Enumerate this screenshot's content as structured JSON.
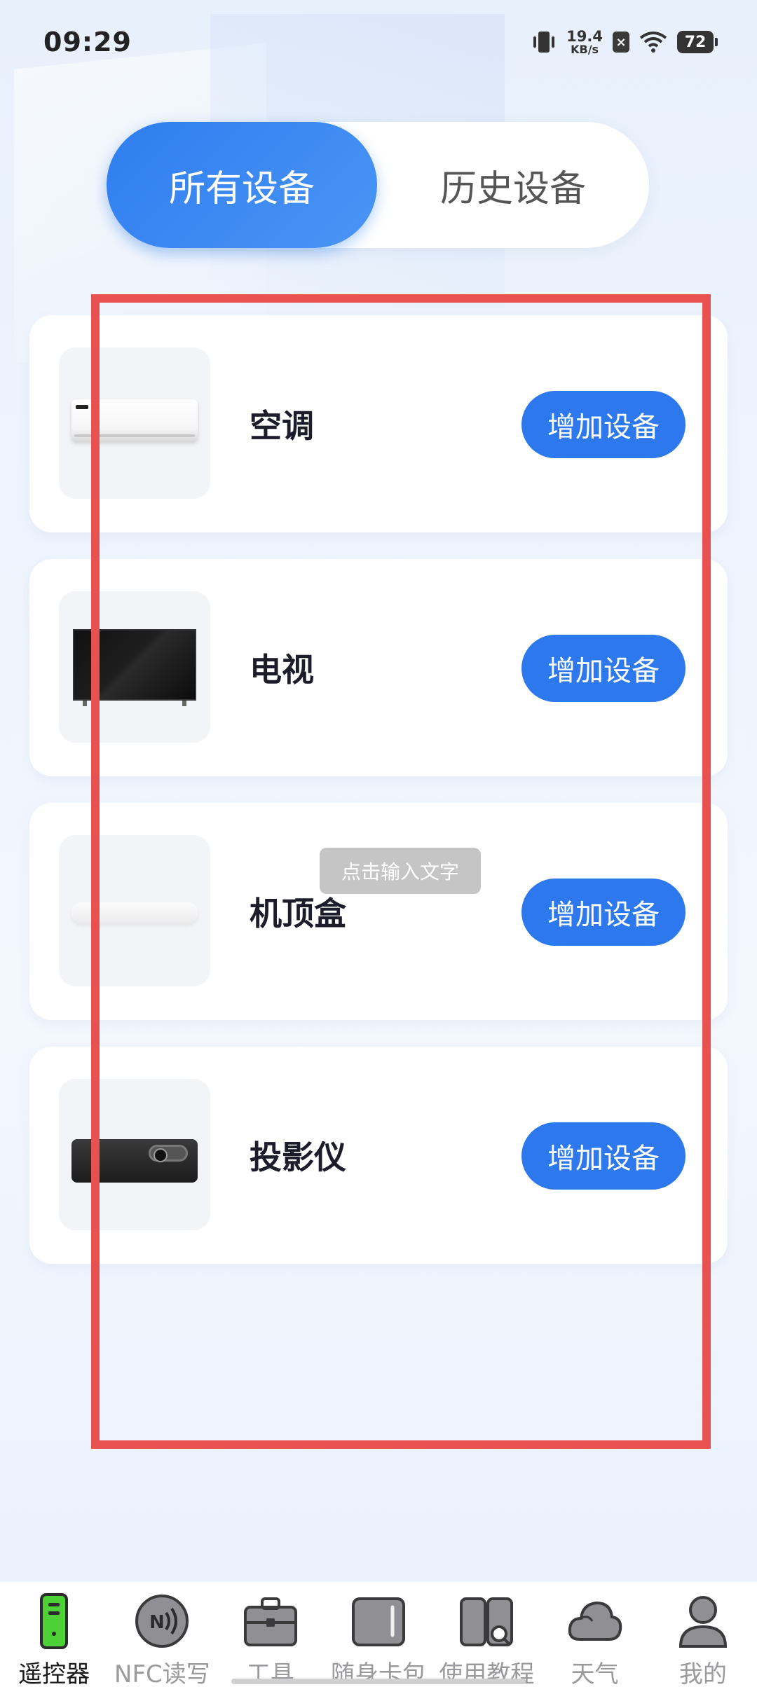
{
  "status_bar": {
    "time": "09:29",
    "net_speed_value": "19.4",
    "net_speed_unit": "KB/s",
    "battery": "72"
  },
  "tabs": [
    {
      "label": "所有设备",
      "active": true
    },
    {
      "label": "历史设备",
      "active": false
    }
  ],
  "devices": [
    {
      "name": "空调",
      "icon": "air-conditioner",
      "button": "增加设备"
    },
    {
      "name": "电视",
      "icon": "television",
      "button": "增加设备"
    },
    {
      "name": "机顶盒",
      "icon": "set-top-box",
      "button": "增加设备"
    },
    {
      "name": "投影仪",
      "icon": "projector",
      "button": "增加设备"
    }
  ],
  "toast": "点击输入文字",
  "bottom_nav": [
    {
      "label": "遥控器",
      "icon": "remote-icon",
      "active": true
    },
    {
      "label": "NFC读写",
      "icon": "nfc-icon",
      "active": false
    },
    {
      "label": "工具",
      "icon": "toolbox-icon",
      "active": false
    },
    {
      "label": "随身卡包",
      "icon": "card-icon",
      "active": false
    },
    {
      "label": "使用教程",
      "icon": "tutorial-icon",
      "active": false
    },
    {
      "label": "天气",
      "icon": "cloud-icon",
      "active": false
    },
    {
      "label": "我的",
      "icon": "user-icon",
      "active": false
    }
  ],
  "colors": {
    "accent": "#2d78ec",
    "active_nav_icon": "#4cd137",
    "selection_box": "#e8514f"
  }
}
